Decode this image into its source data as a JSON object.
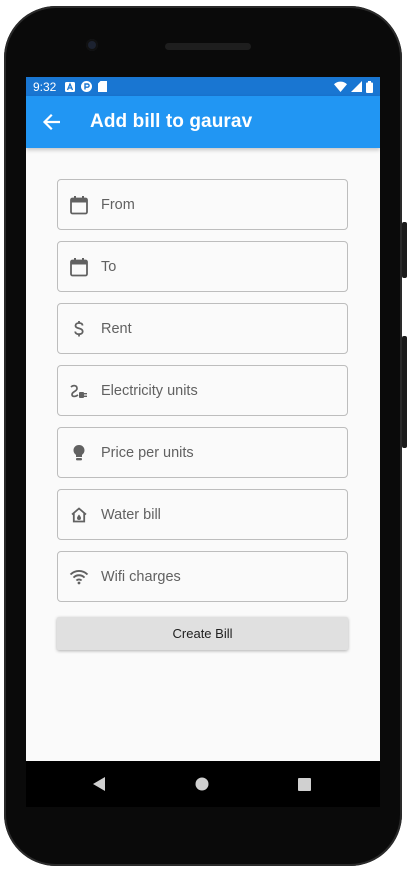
{
  "status_bar": {
    "time": "9:32",
    "icons": [
      "a-notification-icon",
      "app-notification-icon",
      "sd-card-icon"
    ],
    "right_icons": [
      "wifi-icon",
      "signal-icon",
      "battery-icon"
    ]
  },
  "app_bar": {
    "back_icon": "arrow-back-icon",
    "title": "Add bill to gaurav",
    "color": "#2196f3"
  },
  "form": {
    "fields": [
      {
        "placeholder": "From",
        "icon": "calendar-icon",
        "value": ""
      },
      {
        "placeholder": "To",
        "icon": "calendar-icon",
        "value": ""
      },
      {
        "placeholder": "Rent",
        "icon": "dollar-icon",
        "value": ""
      },
      {
        "placeholder": "Electricity units",
        "icon": "power-plug-icon",
        "value": ""
      },
      {
        "placeholder": "Price per units",
        "icon": "lightbulb-icon",
        "value": ""
      },
      {
        "placeholder": "Water bill",
        "icon": "house-icon",
        "value": ""
      },
      {
        "placeholder": "Wifi charges",
        "icon": "wifi-icon",
        "value": ""
      }
    ],
    "submit_label": "Create Bill"
  },
  "nav_bar": {
    "buttons": [
      "back-triangle-icon",
      "home-circle-icon",
      "recents-square-icon"
    ]
  }
}
